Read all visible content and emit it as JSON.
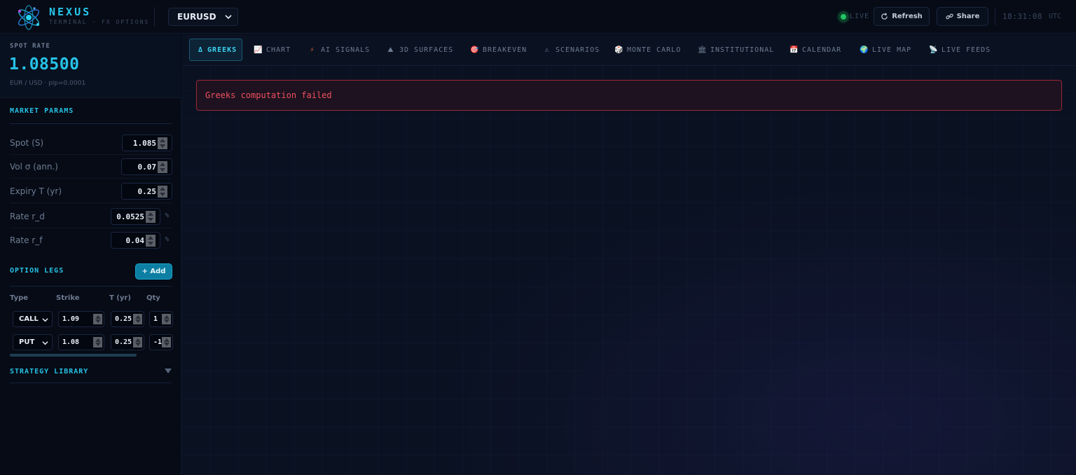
{
  "brand": {
    "name": "NEXUS",
    "subtitle": "TERMINAL · FX OPTIONS"
  },
  "header": {
    "pair": "EURUSD",
    "live_label": "LIVE",
    "refresh_label": "Refresh",
    "share_label": "Share",
    "clock": "18:31:08",
    "timezone": "UTC"
  },
  "spot": {
    "title": "SPOT RATE",
    "value": "1.08500",
    "subtitle": "EUR / USD · pip=0.0001"
  },
  "market_params": {
    "title": "MARKET PARAMS",
    "rows": [
      {
        "label": "Spot (S)",
        "value": "1.085",
        "unit": ""
      },
      {
        "label": "Vol σ (ann.)",
        "value": "0.07",
        "unit": ""
      },
      {
        "label": "Expiry T (yr)",
        "value": "0.25",
        "unit": ""
      },
      {
        "label": "Rate r_d",
        "value": "0.0525",
        "unit": "%"
      },
      {
        "label": "Rate r_f",
        "value": "0.04",
        "unit": "%"
      }
    ]
  },
  "option_legs": {
    "title": "OPTION LEGS",
    "add_label": "+ Add",
    "columns": [
      "Type",
      "Strike",
      "T (yr)",
      "Qty"
    ],
    "legs": [
      {
        "type": "CALL",
        "strike": "1.09",
        "t": "0.25",
        "qty": "1"
      },
      {
        "type": "PUT",
        "strike": "1.08",
        "t": "0.25",
        "qty": "-1"
      }
    ]
  },
  "strategy_library": {
    "title": "STRATEGY LIBRARY"
  },
  "tabs": [
    {
      "label": "GREEKS",
      "icon": "Δ",
      "icon_name": "delta-icon"
    },
    {
      "label": "CHART",
      "icon": "📈",
      "icon_name": "chart-icon"
    },
    {
      "label": "AI SIGNALS",
      "icon": "⚡",
      "icon_name": "lightning-icon"
    },
    {
      "label": "3D SURFACES",
      "icon": "⛰",
      "icon_name": "mountain-icon"
    },
    {
      "label": "BREAKEVEN",
      "icon": "🎯",
      "icon_name": "target-icon"
    },
    {
      "label": "SCENARIOS",
      "icon": "⚠",
      "icon_name": "warning-icon"
    },
    {
      "label": "MONTE CARLO",
      "icon": "🎲",
      "icon_name": "dice-icon"
    },
    {
      "label": "INSTITUTIONAL",
      "icon": "🏛",
      "icon_name": "bank-icon"
    },
    {
      "label": "CALENDAR",
      "icon": "📅",
      "icon_name": "calendar-icon"
    },
    {
      "label": "LIVE MAP",
      "icon": "🌍",
      "icon_name": "globe-icon"
    },
    {
      "label": "LIVE FEEDS",
      "icon": "📡",
      "icon_name": "satellite-icon"
    }
  ],
  "error": {
    "message": "Greeks computation failed"
  },
  "colors": {
    "accent": "#27c6ea",
    "live": "#20c567",
    "error": "#f0505e",
    "background": "#070c19"
  }
}
